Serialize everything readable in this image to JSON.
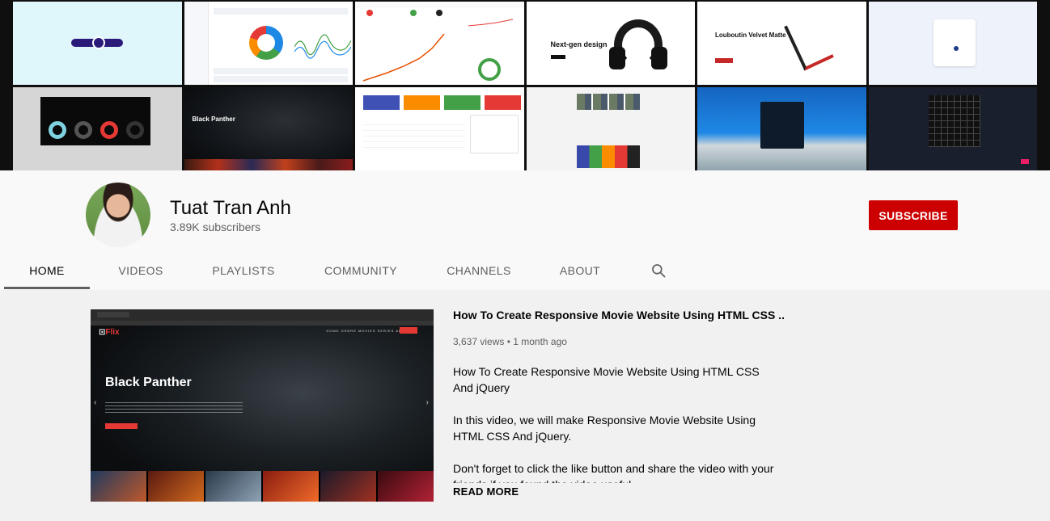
{
  "banner": {
    "tiles": [
      {
        "name": "banner-tile-landing"
      },
      {
        "name": "banner-tile-dashboard"
      },
      {
        "name": "banner-tile-crypto"
      },
      {
        "name": "banner-tile-shop",
        "heading": "Next-gen design"
      },
      {
        "name": "banner-tile-louboutin",
        "heading": "Louboutin Velvet Matte"
      },
      {
        "name": "banner-tile-calendar"
      },
      {
        "name": "banner-tile-headphones"
      },
      {
        "name": "banner-tile-movie",
        "heading": "Black Panther"
      },
      {
        "name": "banner-tile-admin"
      },
      {
        "name": "banner-tile-social"
      },
      {
        "name": "banner-tile-login"
      },
      {
        "name": "banner-tile-sudoku"
      }
    ]
  },
  "channel": {
    "name": "Tuat Tran Anh",
    "subscribers": "3.89K subscribers",
    "subscribe_label": "SUBSCRIBE"
  },
  "tabs": [
    {
      "label": "HOME",
      "active": true
    },
    {
      "label": "VIDEOS"
    },
    {
      "label": "PLAYLISTS"
    },
    {
      "label": "COMMUNITY"
    },
    {
      "label": "CHANNELS"
    },
    {
      "label": "ABOUT"
    }
  ],
  "icons": {
    "search": "search-icon"
  },
  "featured": {
    "title": "How To Create Responsive Movie Website Using HTML CSS ...",
    "meta": "3,637 views • 1 month ago",
    "thumbnail": {
      "logo_prefix": "Flix",
      "movie_title": "Black Panther",
      "nav": "HOME GENRE MOVIES SERIES ABOUT"
    },
    "description": [
      "How To Create Responsive Movie Website Using HTML CSS And jQuery",
      "In this video, we will make Responsive Movie Website Using HTML CSS And jQuery.",
      "Don't forget to click the like button and share the video with your friends if you found the video useful."
    ],
    "read_more": "READ MORE"
  },
  "colors": {
    "subscribe": "#cc0000",
    "page_bg": "#f1f1f1",
    "header_bg": "#f9f9f9",
    "text_secondary": "#606060"
  }
}
